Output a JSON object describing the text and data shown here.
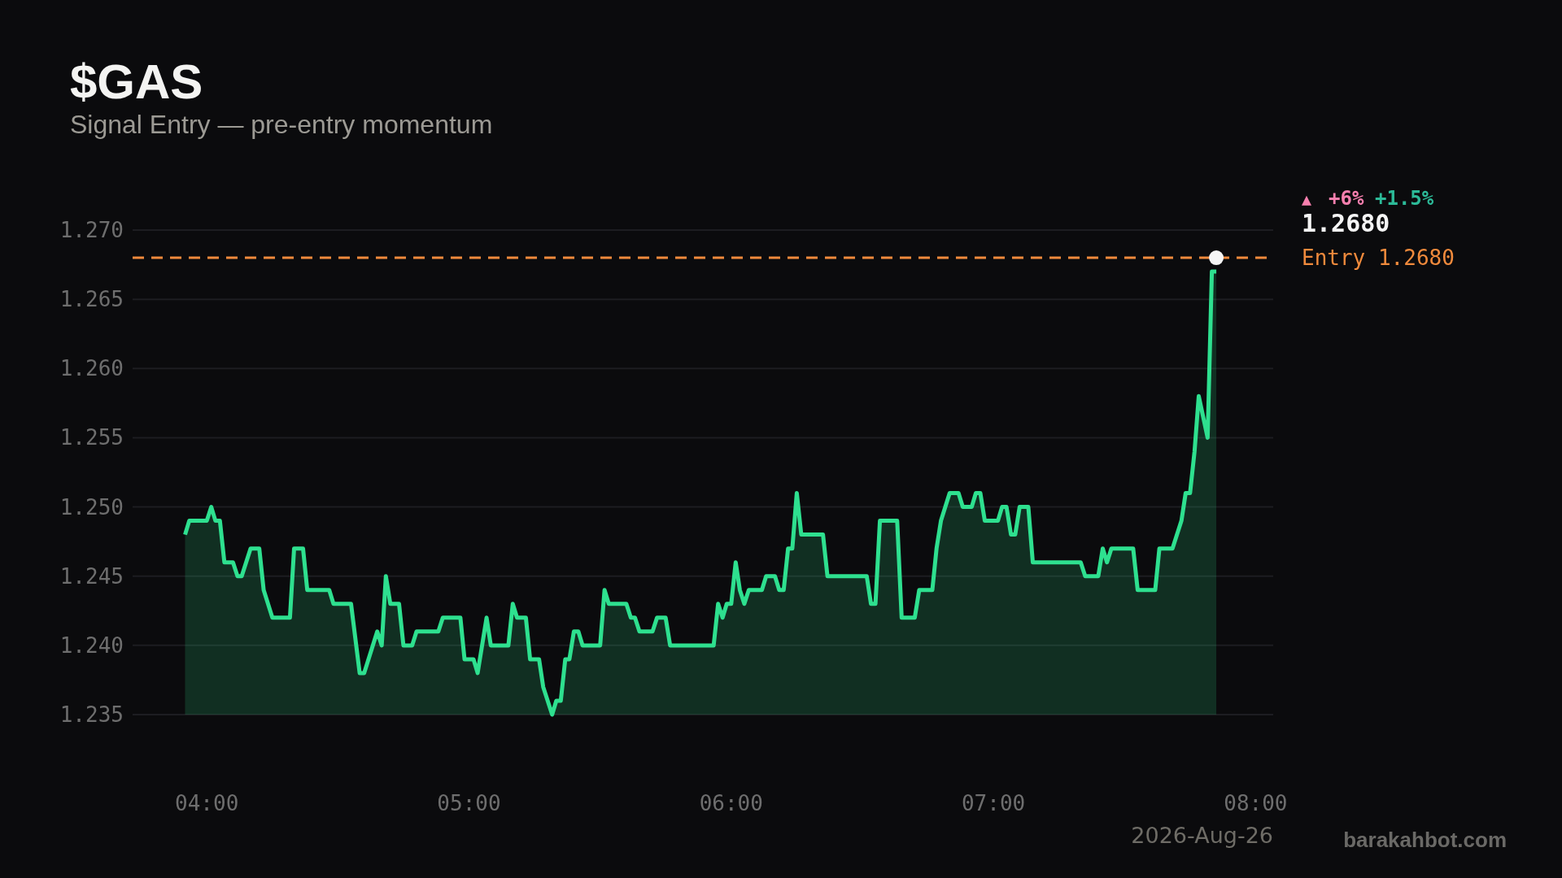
{
  "header": {
    "title": "$GAS",
    "subtitle": "Signal Entry — pre-entry momentum"
  },
  "chart": {
    "chart_data": {
      "type": "area",
      "x": [
        3.917,
        3.933,
        4,
        4.017,
        4.033,
        4.05,
        4.067,
        4.1,
        4.117,
        4.133,
        4.167,
        4.2,
        4.217,
        4.25,
        4.317,
        4.333,
        4.367,
        4.383,
        4.467,
        4.483,
        4.55,
        4.583,
        4.6,
        4.65,
        4.667,
        4.683,
        4.7,
        4.733,
        4.75,
        4.783,
        4.8,
        4.883,
        4.9,
        4.967,
        4.983,
        5.017,
        5.033,
        5.067,
        5.083,
        5.15,
        5.167,
        5.183,
        5.217,
        5.233,
        5.267,
        5.283,
        5.317,
        5.333,
        5.35,
        5.367,
        5.383,
        5.4,
        5.417,
        5.433,
        5.5,
        5.517,
        5.533,
        5.6,
        5.617,
        5.633,
        5.65,
        5.7,
        5.717,
        5.75,
        5.767,
        5.933,
        5.95,
        5.967,
        5.983,
        6,
        6.017,
        6.033,
        6.05,
        6.067,
        6.117,
        6.133,
        6.167,
        6.183,
        6.2,
        6.217,
        6.233,
        6.25,
        6.267,
        6.35,
        6.367,
        6.517,
        6.533,
        6.55,
        6.567,
        6.633,
        6.65,
        6.7,
        6.717,
        6.767,
        6.783,
        6.8,
        6.833,
        6.867,
        6.883,
        6.917,
        6.933,
        6.95,
        6.967,
        7.017,
        7.033,
        7.05,
        7.067,
        7.083,
        7.1,
        7.133,
        7.15,
        7.333,
        7.35,
        7.4,
        7.417,
        7.433,
        7.45,
        7.533,
        7.55,
        7.617,
        7.633,
        7.683,
        7.717,
        7.733,
        7.75,
        7.767,
        7.783,
        7.817,
        7.833,
        7.85
      ],
      "series": [
        {
          "color": "#2ee08f",
          "values": [
            1.248,
            1.249,
            1.249,
            1.25,
            1.249,
            1.249,
            1.246,
            1.246,
            1.245,
            1.245,
            1.247,
            1.247,
            1.244,
            1.242,
            1.242,
            1.247,
            1.247,
            1.244,
            1.244,
            1.243,
            1.243,
            1.238,
            1.238,
            1.241,
            1.24,
            1.245,
            1.243,
            1.243,
            1.24,
            1.24,
            1.241,
            1.241,
            1.242,
            1.242,
            1.239,
            1.239,
            1.238,
            1.242,
            1.24,
            1.24,
            1.243,
            1.242,
            1.242,
            1.239,
            1.239,
            1.237,
            1.235,
            1.236,
            1.236,
            1.239,
            1.239,
            1.241,
            1.241,
            1.24,
            1.24,
            1.244,
            1.243,
            1.243,
            1.242,
            1.242,
            1.241,
            1.241,
            1.242,
            1.242,
            1.24,
            1.24,
            1.243,
            1.242,
            1.243,
            1.243,
            1.246,
            1.244,
            1.243,
            1.244,
            1.244,
            1.245,
            1.245,
            1.244,
            1.244,
            1.247,
            1.247,
            1.251,
            1.248,
            1.248,
            1.245,
            1.245,
            1.243,
            1.243,
            1.249,
            1.249,
            1.242,
            1.242,
            1.244,
            1.244,
            1.247,
            1.249,
            1.251,
            1.251,
            1.25,
            1.25,
            1.251,
            1.251,
            1.249,
            1.249,
            1.25,
            1.25,
            1.248,
            1.248,
            1.25,
            1.25,
            1.246,
            1.246,
            1.245,
            1.245,
            1.247,
            1.246,
            1.247,
            1.247,
            1.244,
            1.244,
            1.247,
            1.247,
            1.249,
            1.251,
            1.251,
            1.254,
            1.258,
            1.255,
            1.267,
            1.267
          ]
        }
      ],
      "xlim": [
        3.717,
        8.067
      ],
      "ylim": [
        1.235,
        1.27
      ],
      "xticks": [
        {
          "value": 4,
          "label": "04:00"
        },
        {
          "value": 5,
          "label": "05:00"
        },
        {
          "value": 6,
          "label": "06:00"
        },
        {
          "value": 7,
          "label": "07:00"
        },
        {
          "value": 8,
          "label": "08:00"
        }
      ],
      "yticks": [
        {
          "value": 1.235,
          "label": "1.235"
        },
        {
          "value": 1.24,
          "label": "1.240"
        },
        {
          "value": 1.245,
          "label": "1.245"
        },
        {
          "value": 1.25,
          "label": "1.250"
        },
        {
          "value": 1.255,
          "label": "1.255"
        },
        {
          "value": 1.26,
          "label": "1.260"
        },
        {
          "value": 1.265,
          "label": "1.265"
        },
        {
          "value": 1.27,
          "label": "1.270"
        }
      ],
      "grid": true,
      "ref_lines": [
        {
          "axis": "y",
          "value": 1.268,
          "label": "Entry 1.2680"
        }
      ]
    },
    "change": {
      "arrow": "▲",
      "text": "+6%",
      "text_2": "+1.5%"
    },
    "last_price": "1.2680",
    "date": "2026-Aug-26"
  },
  "credit": "barakahbot.com"
}
